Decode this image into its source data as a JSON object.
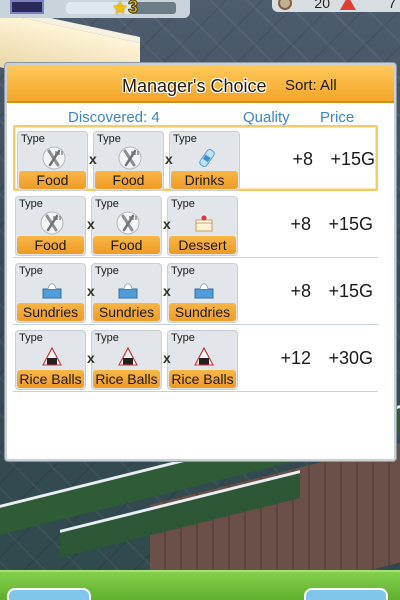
{
  "hud": {
    "level": "3",
    "exp_fraction": 0.6,
    "stat_a": "20",
    "stat_b": "7"
  },
  "dialog": {
    "title": "Manager's Choice",
    "sort_label": "Sort: All",
    "columns": {
      "discovered": "Discovered: 4",
      "quality": "Quality",
      "price": "Price"
    },
    "slot_type_label": "Type",
    "separator": "x",
    "combos": [
      {
        "slots": [
          {
            "label": "Food",
            "icon": "fork-knife-icon"
          },
          {
            "label": "Food",
            "icon": "fork-knife-icon"
          },
          {
            "label": "Drinks",
            "icon": "drink-bottle-icon"
          }
        ],
        "quality": "+8",
        "price": "+15G",
        "selected": true
      },
      {
        "slots": [
          {
            "label": "Food",
            "icon": "fork-knife-icon"
          },
          {
            "label": "Food",
            "icon": "fork-knife-icon"
          },
          {
            "label": "Dessert",
            "icon": "cake-icon"
          }
        ],
        "quality": "+8",
        "price": "+15G",
        "selected": false
      },
      {
        "slots": [
          {
            "label": "Sundries",
            "icon": "tissue-box-icon"
          },
          {
            "label": "Sundries",
            "icon": "tissue-box-icon"
          },
          {
            "label": "Sundries",
            "icon": "tissue-box-icon"
          }
        ],
        "quality": "+8",
        "price": "+15G",
        "selected": false
      },
      {
        "slots": [
          {
            "label": "Rice Balls",
            "icon": "rice-ball-icon"
          },
          {
            "label": "Rice Balls",
            "icon": "rice-ball-icon"
          },
          {
            "label": "Rice Balls",
            "icon": "rice-ball-icon"
          }
        ],
        "quality": "+12",
        "price": "+30G",
        "selected": false
      }
    ]
  },
  "colors": {
    "header_orange": "#f3a52a",
    "label_orange": "#ef9a26",
    "column_blue": "#3a86c8",
    "bottom_green": "#5faf2e"
  }
}
